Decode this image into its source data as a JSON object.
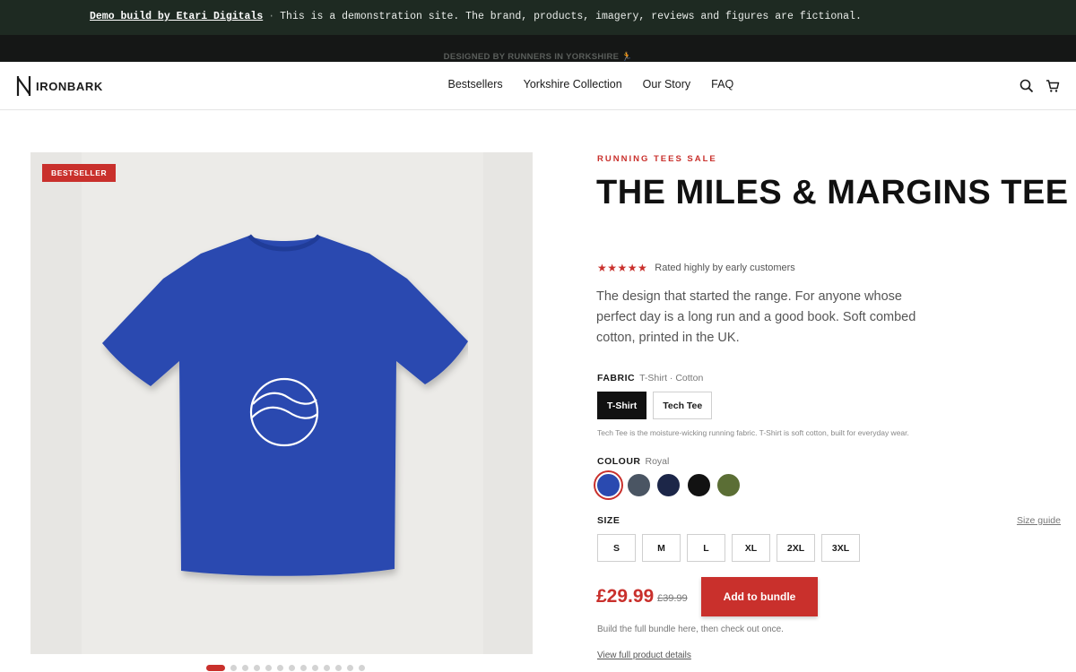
{
  "demo_banner": {
    "strong": "Demo build by Etari Digitals",
    "separator": "·",
    "text": "This is a demonstration site. The brand, products, imagery, reviews and figures are fictional."
  },
  "announcement": "DESIGNED BY RUNNERS IN YORKSHIRE 🏃",
  "brand": "IRONBARK",
  "nav": [
    "Bestsellers",
    "Yorkshire Collection",
    "Our Story",
    "FAQ"
  ],
  "header_icons": [
    "search-icon",
    "cart-icon"
  ],
  "gallery": {
    "badge": "BESTSELLER",
    "image": "royal-blue-tshirt-with-wave-circle-logo",
    "slide_count": 13,
    "active_slide": 1
  },
  "product": {
    "eyebrow": "RUNNING TEES SALE",
    "title": "THE MILES & MARGINS TEE",
    "stars": "★★★★★",
    "rating_text": "Rated highly by early customers",
    "description": "The design that started the range. For anyone whose perfect day is a long run and a good book. Soft combed cotton, printed in the UK."
  },
  "fabric": {
    "label": "FABRIC",
    "value": "T-Shirt · Cotton",
    "options": [
      "T-Shirt",
      "Tech Tee"
    ],
    "selected": "T-Shirt",
    "note": "Tech Tee is the moisture-wicking running fabric. T-Shirt is soft cotton, built for everyday wear."
  },
  "colour": {
    "label": "COLOUR",
    "value": "Royal",
    "swatches": [
      "#2a4ab0",
      "#4a5563",
      "#1c2648",
      "#121212",
      "#5b6e35"
    ],
    "selected_index": 0
  },
  "size": {
    "label": "SIZE",
    "guide": "Size guide",
    "options": [
      "S",
      "M",
      "L",
      "XL",
      "2XL",
      "3XL"
    ]
  },
  "purchase": {
    "price": "£29.99",
    "was_price": "£39.99",
    "button": "Add to bundle",
    "note": "Build the full bundle here, then check out once.",
    "details_link": "View full product details"
  },
  "colors": {
    "accent": "#c9302c",
    "banner": "#1e2a22",
    "tee": "#2a4ab0"
  }
}
